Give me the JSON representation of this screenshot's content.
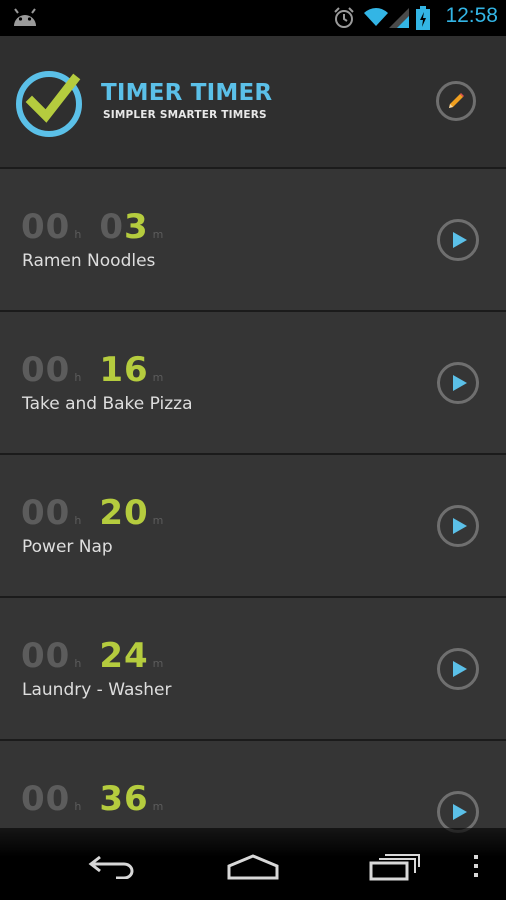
{
  "status_bar": {
    "time": "12:58",
    "icons": [
      "android-icon",
      "alarm-icon",
      "wifi-icon",
      "signal-icon",
      "battery-charging-icon"
    ],
    "accent_color": "#33b5e5"
  },
  "header": {
    "title": "TIMER TIMER",
    "subtitle": "SIMPLER SMARTER TIMERS",
    "logo_icon": "check-clock-icon",
    "edit_icon": "pencil-icon"
  },
  "timers": [
    {
      "hours": "00",
      "hours_unit": "h",
      "minutes_dim": "0",
      "minutes_lit": "3",
      "minutes_unit": "m",
      "name": "Ramen Noodles"
    },
    {
      "hours": "00",
      "hours_unit": "h",
      "minutes_dim": "",
      "minutes_lit": "16",
      "minutes_unit": "m",
      "name": "Take and Bake Pizza"
    },
    {
      "hours": "00",
      "hours_unit": "h",
      "minutes_dim": "",
      "minutes_lit": "20",
      "minutes_unit": "m",
      "name": "Power Nap"
    },
    {
      "hours": "00",
      "hours_unit": "h",
      "minutes_dim": "",
      "minutes_lit": "24",
      "minutes_unit": "m",
      "name": "Laundry - Washer"
    },
    {
      "hours": "00",
      "hours_unit": "h",
      "minutes_dim": "",
      "minutes_lit": "36",
      "minutes_unit": "m",
      "name": ""
    }
  ],
  "colors": {
    "title_blue": "#5bc0e8",
    "minutes_green": "#b5cc3e",
    "dim_gray": "#5c5c5c"
  },
  "nav_bar": {
    "icons": [
      "back-icon",
      "home-icon",
      "recent-apps-icon",
      "overflow-menu-icon"
    ]
  }
}
